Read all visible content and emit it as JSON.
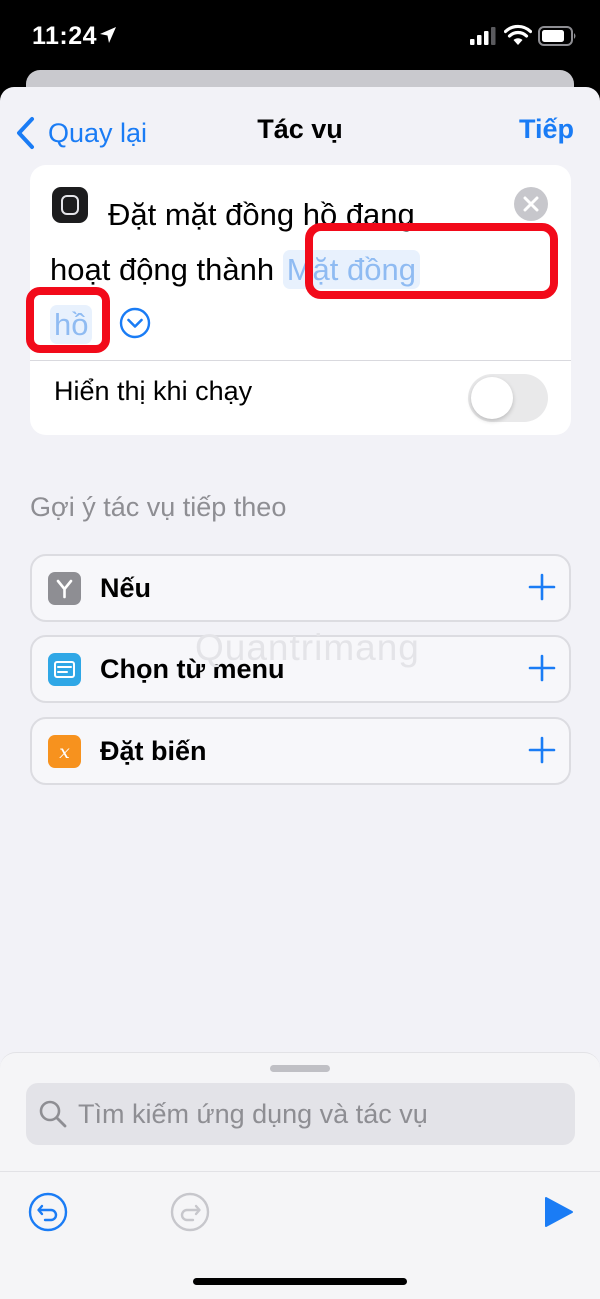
{
  "status_bar": {
    "time": "11:24",
    "icons": [
      "location-arrow-icon",
      "cellular-signal-icon",
      "wifi-icon",
      "battery-icon"
    ]
  },
  "nav": {
    "back_label": "Quay lại",
    "title": "Tác vụ",
    "next_label": "Tiếp"
  },
  "action": {
    "app_icon": "watch-face-icon",
    "text_line1": "Đặt mặt đồng hồ đang",
    "text_line2": "hoạt động thành",
    "param_part1": "Mặt đồng",
    "param_part2": "hồ",
    "show_when_run_label": "Hiển thị khi chạy",
    "show_when_run_enabled": false
  },
  "suggestions": {
    "heading": "Gợi ý tác vụ tiếp theo",
    "items": [
      {
        "label": "Nếu",
        "icon": "branch-icon",
        "color": "#8e8e93"
      },
      {
        "label": "Chọn từ menu",
        "icon": "menu-icon",
        "color": "#2fa7e6"
      },
      {
        "label": "Đặt biến",
        "icon": "variable-x-icon",
        "color": "#f7921e"
      }
    ]
  },
  "watermark": "Quantrimang",
  "search": {
    "placeholder": "Tìm kiếm ứng dụng và tác vụ"
  },
  "colors": {
    "accent": "#1a7cf5",
    "highlight_frame": "#f20a1a",
    "parameter_text": "#8fbbf2"
  }
}
